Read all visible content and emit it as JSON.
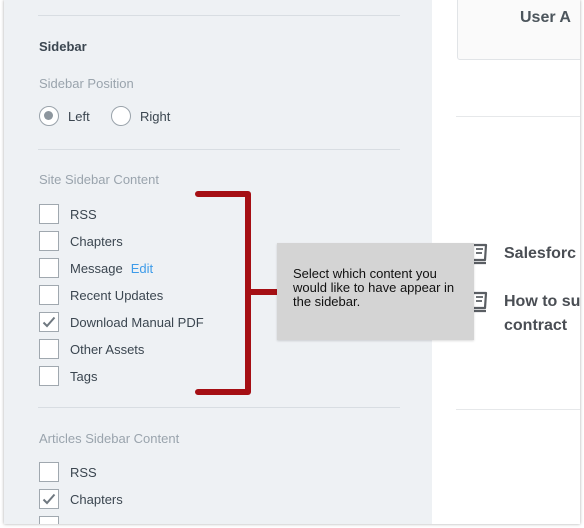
{
  "sidebar": {
    "section_title": "Sidebar",
    "position": {
      "label": "Sidebar Position",
      "options": [
        {
          "label": "Left",
          "checked": true
        },
        {
          "label": "Right",
          "checked": false
        }
      ]
    },
    "site_content": {
      "label": "Site Sidebar Content",
      "items": [
        {
          "label": "RSS",
          "checked": false
        },
        {
          "label": "Chapters",
          "checked": false
        },
        {
          "label": "Message",
          "checked": false,
          "link": "Edit"
        },
        {
          "label": "Recent Updates",
          "checked": false
        },
        {
          "label": "Download Manual PDF",
          "checked": true
        },
        {
          "label": "Other Assets",
          "checked": false
        },
        {
          "label": "Tags",
          "checked": false
        }
      ]
    },
    "articles_content": {
      "label": "Articles Sidebar Content",
      "items": [
        {
          "label": "RSS",
          "checked": false
        },
        {
          "label": "Chapters",
          "checked": true
        }
      ]
    }
  },
  "annotation": {
    "text": "Select which content you would like to have appear in the sidebar.",
    "color": "#a50f14",
    "background": "#d4d4d4"
  },
  "page": {
    "user_card_text": "User A",
    "documents": [
      {
        "icon": "book-icon",
        "lines": [
          "Salesforc"
        ]
      },
      {
        "icon": "book-icon",
        "lines": [
          "How to su",
          "contract"
        ]
      }
    ]
  }
}
